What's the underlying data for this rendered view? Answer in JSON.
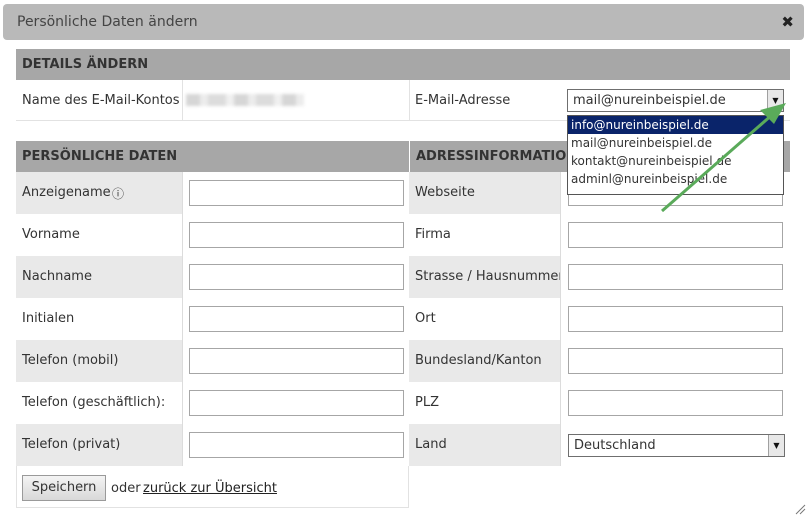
{
  "dialog": {
    "title": "Persönliche Daten ändern",
    "close_glyph": "✖"
  },
  "details": {
    "header": "Details ändern",
    "account_label": "Name des E-Mail-Kontos",
    "email_label": "E-Mail-Adresse",
    "email_selected": "mail@nureinbeispiel.de",
    "email_options": [
      "info@nureinbeispiel.de",
      "mail@nureinbeispiel.de",
      "kontakt@nureinbeispiel.de",
      "adminl@nureinbeispiel.de"
    ]
  },
  "personal": {
    "header": "Persönliche Daten",
    "info_glyph": "ⓘ",
    "fields": [
      "Anzeigename",
      "Vorname",
      "Nachname",
      "Initialen",
      "Telefon (mobil)",
      "Telefon (geschäftlich):",
      "Telefon (privat)"
    ]
  },
  "address": {
    "header": "Adressinformationen",
    "fields": [
      "Webseite",
      "Firma",
      "Strasse / Hausnummer",
      "Ort",
      "Bundesland/Kanton",
      "PLZ",
      "Land"
    ],
    "country_value": "Deutschland"
  },
  "footer": {
    "save_label": "Speichern",
    "or_text": "oder",
    "back_link": "zurück zur Übersicht"
  },
  "colors": {
    "header_bg": "#a7a7a7",
    "row_alt": "#e9e9e9",
    "highlight": "#0a246a",
    "arrow": "#5aaa5a"
  }
}
